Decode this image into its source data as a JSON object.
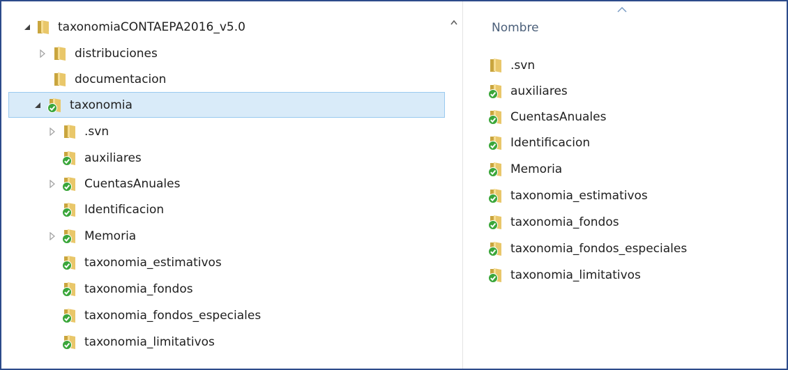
{
  "tree": {
    "root": {
      "label": "taxonomiaCONTAEPA2016_v5.0",
      "icon": "folder-icon"
    },
    "items": [
      {
        "label": "distribuciones",
        "icon": "folder-icon",
        "expander": "collapsed"
      },
      {
        "label": "documentacion",
        "icon": "folder-icon",
        "expander": "none"
      },
      {
        "label": "taxonomia",
        "icon": "svn-folder-icon",
        "expander": "expanded",
        "selected": true
      },
      {
        "label": ".svn",
        "icon": "folder-icon",
        "expander": "collapsed"
      },
      {
        "label": "auxiliares",
        "icon": "svn-folder-icon",
        "expander": "none"
      },
      {
        "label": "CuentasAnuales",
        "icon": "svn-folder-icon",
        "expander": "collapsed"
      },
      {
        "label": "Identificacion",
        "icon": "svn-folder-icon",
        "expander": "none"
      },
      {
        "label": "Memoria",
        "icon": "svn-folder-icon",
        "expander": "collapsed"
      },
      {
        "label": "taxonomia_estimativos",
        "icon": "svn-folder-icon",
        "expander": "none"
      },
      {
        "label": "taxonomia_fondos",
        "icon": "svn-folder-icon",
        "expander": "none"
      },
      {
        "label": "taxonomia_fondos_especiales",
        "icon": "svn-folder-icon",
        "expander": "none"
      },
      {
        "label": "taxonomia_limitativos",
        "icon": "svn-folder-icon",
        "expander": "none"
      }
    ]
  },
  "content": {
    "column_header": "Nombre",
    "files": [
      {
        "label": ".svn",
        "icon": "folder-icon"
      },
      {
        "label": "auxiliares",
        "icon": "svn-folder-icon"
      },
      {
        "label": "CuentasAnuales",
        "icon": "svn-folder-icon"
      },
      {
        "label": "Identificacion",
        "icon": "svn-folder-icon"
      },
      {
        "label": "Memoria",
        "icon": "svn-folder-icon"
      },
      {
        "label": "taxonomia_estimativos",
        "icon": "svn-folder-icon"
      },
      {
        "label": "taxonomia_fondos",
        "icon": "svn-folder-icon"
      },
      {
        "label": "taxonomia_fondos_especiales",
        "icon": "svn-folder-icon"
      },
      {
        "label": "taxonomia_limitativos",
        "icon": "svn-folder-icon"
      }
    ]
  },
  "colors": {
    "selection_bg": "#d9ebf9",
    "selection_border": "#99c9ef",
    "folder": "#e9c76a",
    "svn_badge": "#3aa63a",
    "window_border": "#2c4a8a"
  }
}
